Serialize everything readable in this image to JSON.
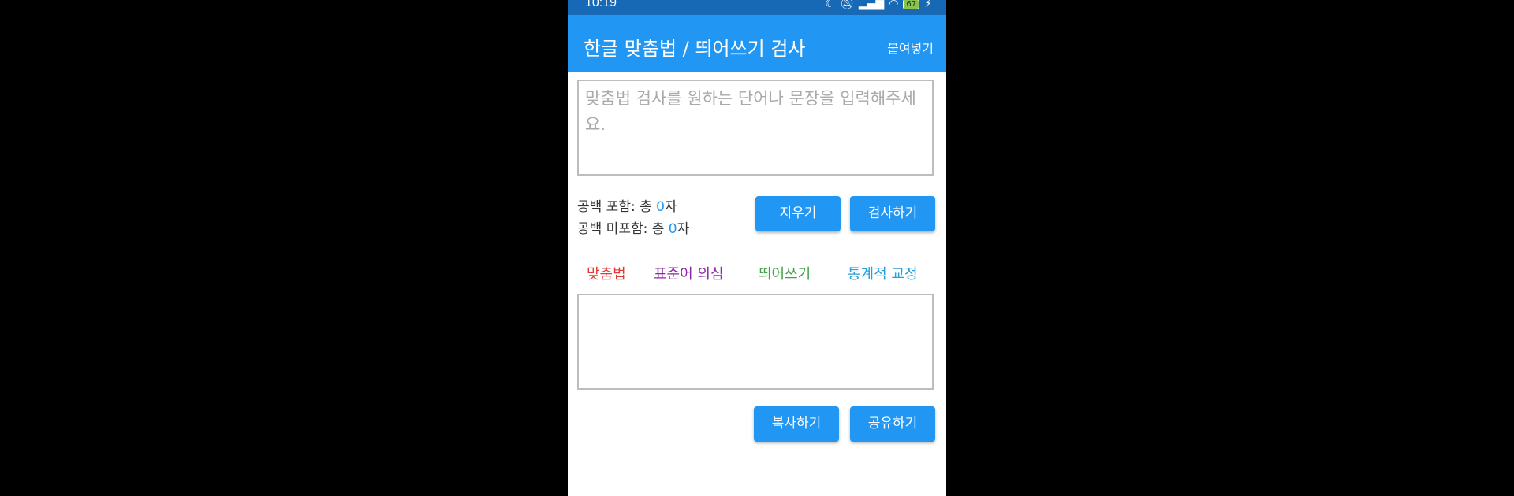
{
  "status_bar": {
    "time": "10:19",
    "battery": "67"
  },
  "app_bar": {
    "title": "한글 맞춤법 / 띄어쓰기 검사",
    "paste_label": "붙여넣기"
  },
  "input": {
    "placeholder": "맞춤법 검사를 원하는 단어나 문장을 입력해주세요.",
    "value": ""
  },
  "counts": {
    "with_spaces_prefix": "공백 포함: 총 ",
    "with_spaces_value": "0",
    "without_spaces_prefix": "공백 미포함: 총 ",
    "without_spaces_value": "0",
    "suffix": "자"
  },
  "buttons": {
    "clear": "지우기",
    "check": "검사하기",
    "copy": "복사하기",
    "share": "공유하기"
  },
  "legend": [
    {
      "label": "맞춤법",
      "color": "#e53935"
    },
    {
      "label": "표준어 의심",
      "color": "#8e24aa"
    },
    {
      "label": "띄어쓰기",
      "color": "#43a047"
    },
    {
      "label": "통계적 교정",
      "color": "#26a0d8"
    }
  ],
  "colors": {
    "accent": "#2196f3",
    "status_bar": "#1769b5"
  },
  "output": {
    "text": ""
  }
}
